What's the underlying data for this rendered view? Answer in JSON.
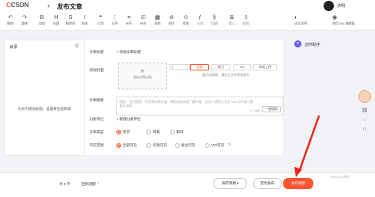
{
  "header": {
    "logo": "CSDN",
    "back": "‹",
    "title": "发布文章",
    "user": "洪明"
  },
  "toolbar": {
    "items": [
      {
        "icon": "↶",
        "label": "撤销"
      },
      {
        "icon": "↷",
        "label": "重做"
      },
      {
        "icon": "B",
        "label": "加粗"
      },
      {
        "icon": "H",
        "label": "标题"
      },
      {
        "icon": "S",
        "label": "删除线"
      },
      {
        "icon": "I",
        "label": "斜体"
      },
      {
        "icon": "❝",
        "label": "引用"
      },
      {
        "icon": "⋮",
        "label": "无序"
      },
      {
        "icon": "≡",
        "label": "有序"
      },
      {
        "icon": "☑",
        "label": "待办"
      },
      {
        "icon": "▦",
        "label": "表格"
      },
      {
        "icon": "⊘",
        "label": "图片"
      },
      {
        "icon": "⊙",
        "label": "视频"
      },
      {
        "icon": "ƒ",
        "label": "公式"
      },
      {
        "icon": "§",
        "label": "目录"
      },
      {
        "icon": "≣",
        "label": "导入"
      },
      {
        "icon": "⇧",
        "label": "导出"
      },
      {
        "icon": "◐",
        "label": "语法说明"
      },
      {
        "icon": "◉",
        "label": "使用 MD 编辑器"
      }
    ]
  },
  "toc": {
    "title": "目录",
    "hint": "为文内增加标题，设置将生成目录"
  },
  "form": {
    "title_label": "文章标题",
    "add_title": "添加文章标题",
    "cover_label": "添加封面",
    "cover_box": "添加文章封面",
    "cover_search_placeholder": "Q",
    "cover_tags": [
      "全部",
      "热门",
      "VIP",
      "本地上传"
    ],
    "cover_empty": "暂无内容图，请在正文中添加图片",
    "summary_label": "文章摘要",
    "summary_placeholder": "摘要：会在推荐、列表等场景外露，帮助读者快速了解内容，支持一键将正文前 256 字符键入摘要文本框",
    "summary_count": "0 / 256",
    "ai_button": "一键提取",
    "column_label": "分类专栏",
    "add_column": "新建分类专栏",
    "type_label": "文章类型",
    "types": [
      "原创",
      "转载",
      "翻译"
    ],
    "visibility_label": "可见范围",
    "visibility": [
      "全部可见",
      "仅我可见",
      "粉丝可见",
      "VIP可见"
    ]
  },
  "right_panel": {
    "creation_tool": "创作助手"
  },
  "bottom": {
    "count": "共 0 字",
    "back_top": "回到顶部",
    "save_draft": "保存草稿",
    "timed_publish": "定时发布",
    "publish": "发布博客",
    "watermark": "CSDN @洪明"
  },
  "colors": {
    "accent": "#fc5531",
    "annotation_arrow": "#e8291c"
  }
}
